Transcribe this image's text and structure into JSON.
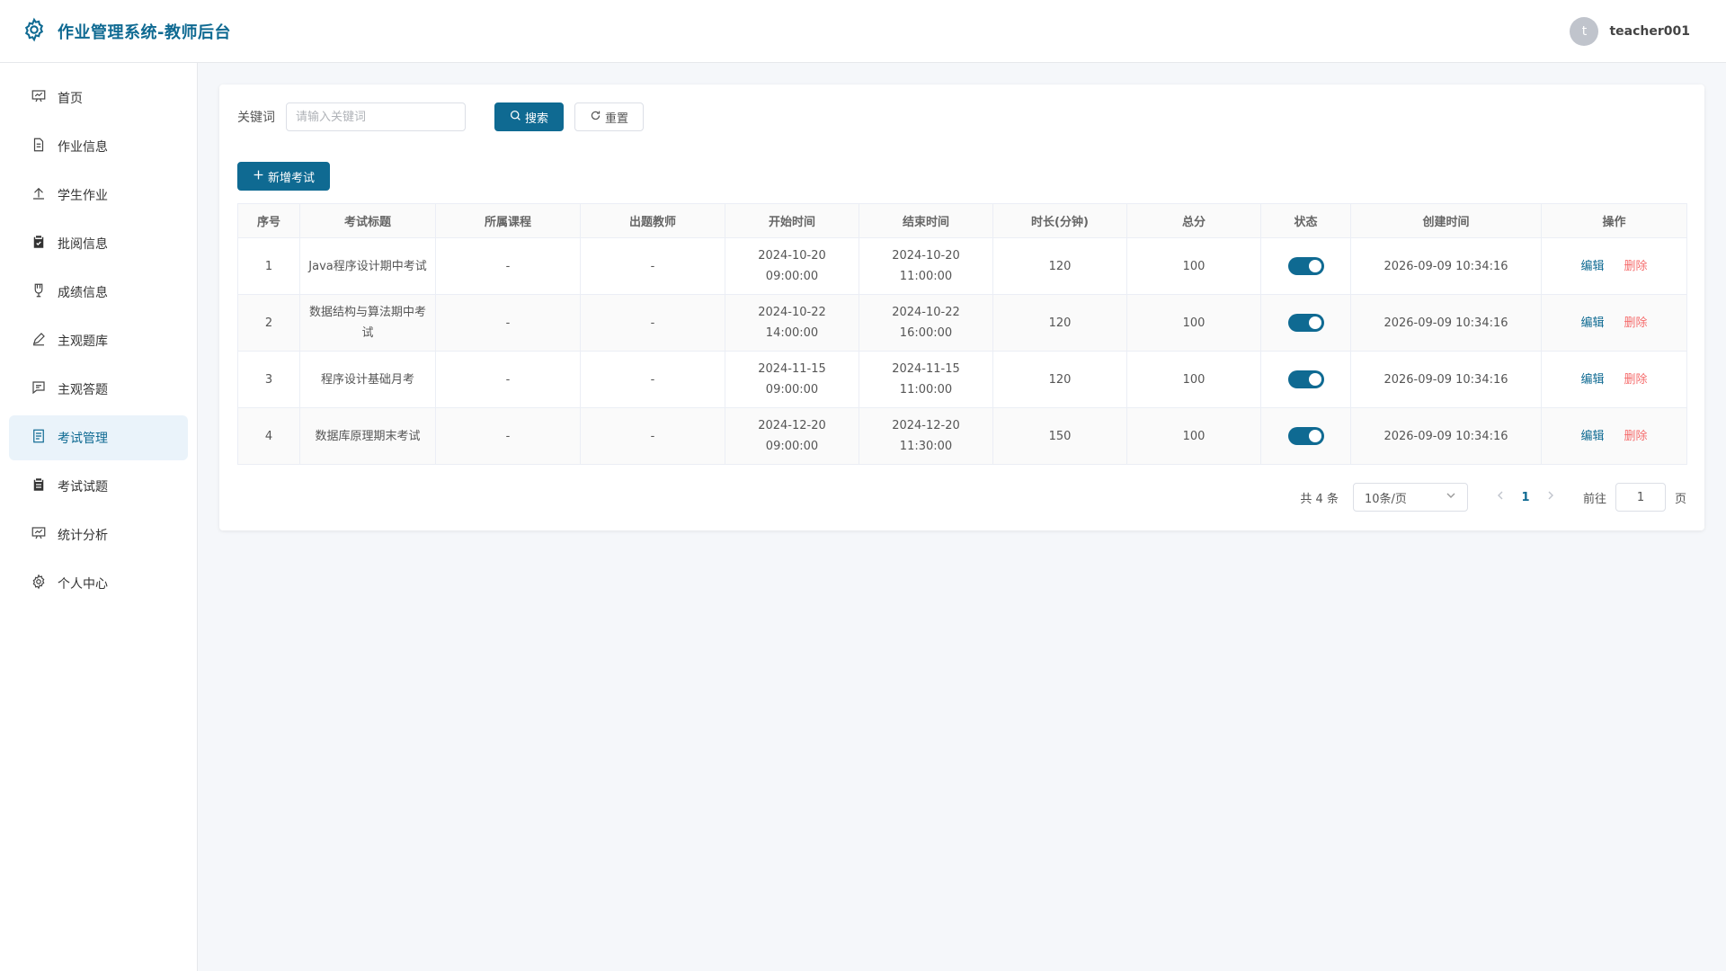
{
  "header": {
    "title": "作业管理系统-教师后台",
    "avatar_letter": "t",
    "username": "teacher001"
  },
  "sidebar": {
    "items": [
      {
        "label": "首页",
        "icon": "presentation-icon"
      },
      {
        "label": "作业信息",
        "icon": "document-icon"
      },
      {
        "label": "学生作业",
        "icon": "upload-icon"
      },
      {
        "label": "批阅信息",
        "icon": "clipboard-check-icon"
      },
      {
        "label": "成绩信息",
        "icon": "medal-icon"
      },
      {
        "label": "主观题库",
        "icon": "edit-pen-icon"
      },
      {
        "label": "主观答题",
        "icon": "chat-icon"
      },
      {
        "label": "考试管理",
        "icon": "document-list-icon"
      },
      {
        "label": "考试试题",
        "icon": "clipboard-filled-icon"
      },
      {
        "label": "统计分析",
        "icon": "chart-board-icon"
      },
      {
        "label": "个人中心",
        "icon": "gear-icon"
      }
    ],
    "active_index": 7
  },
  "search": {
    "label": "关键词",
    "placeholder": "请输入关键词",
    "search_label": "搜索",
    "reset_label": "重置"
  },
  "toolbar": {
    "add_label": "新增考试"
  },
  "table": {
    "columns": [
      "序号",
      "考试标题",
      "所属课程",
      "出题教师",
      "开始时间",
      "结束时间",
      "时长(分钟)",
      "总分",
      "状态",
      "创建时间",
      "操作"
    ],
    "rows": [
      {
        "index": "1",
        "title": "Java程序设计期中考试",
        "course": "-",
        "teacher": "-",
        "start": "2024-10-20 09:00:00",
        "end": "2024-10-20 11:00:00",
        "duration": "120",
        "score": "100",
        "status": true,
        "created": "2026-09-09 10:34:16"
      },
      {
        "index": "2",
        "title": "数据结构与算法期中考试",
        "course": "-",
        "teacher": "-",
        "start": "2024-10-22 14:00:00",
        "end": "2024-10-22 16:00:00",
        "duration": "120",
        "score": "100",
        "status": true,
        "created": "2026-09-09 10:34:16"
      },
      {
        "index": "3",
        "title": "程序设计基础月考",
        "course": "-",
        "teacher": "-",
        "start": "2024-11-15 09:00:00",
        "end": "2024-11-15 11:00:00",
        "duration": "120",
        "score": "100",
        "status": true,
        "created": "2026-09-09 10:34:16"
      },
      {
        "index": "4",
        "title": "数据库原理期末考试",
        "course": "-",
        "teacher": "-",
        "start": "2024-12-20 09:00:00",
        "end": "2024-12-20 11:30:00",
        "duration": "150",
        "score": "100",
        "status": true,
        "created": "2026-09-09 10:34:16"
      }
    ],
    "edit_label": "编辑",
    "delete_label": "删除"
  },
  "pagination": {
    "total_text": "共 4 条",
    "page_size": "10条/页",
    "current_page": "1",
    "goto_label": "前往",
    "goto_value": "1",
    "goto_suffix": "页"
  },
  "colors": {
    "primary": "#0f6a92",
    "danger": "#f56c6c",
    "active_bg": "#eaf3fa"
  }
}
